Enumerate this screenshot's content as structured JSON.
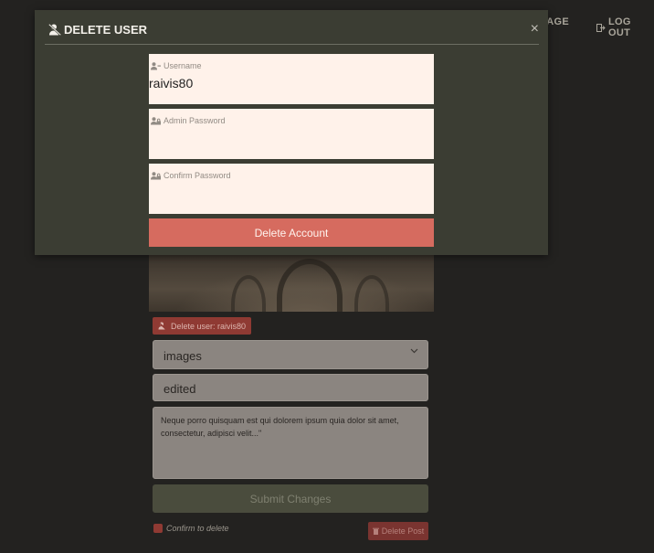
{
  "nav": {
    "manage_label": "NAGE",
    "logout_label": "LOG OUT"
  },
  "post_editor": {
    "delete_user_chip": "Delete user: raivis80",
    "category_value": "images",
    "title_value": "edited",
    "body_value": "Neque porro quisquam est qui dolorem ipsum quia dolor sit amet, consectetur, adipisci velit...\"",
    "submit_label": "Submit Changes",
    "confirm_label": "Confirm to delete",
    "delete_post_label": "Delete Post"
  },
  "modal": {
    "title": "DELETE USER",
    "close_glyph": "×",
    "username_label": "Username",
    "username_value": "raivis80",
    "admin_password_label": "Admin Password",
    "confirm_password_label": "Confirm Password",
    "delete_account_label": "Delete Account"
  },
  "colors": {
    "modal_bg": "#3b3d33",
    "field_bg": "#fff2ea",
    "danger": "#d66b5f"
  }
}
